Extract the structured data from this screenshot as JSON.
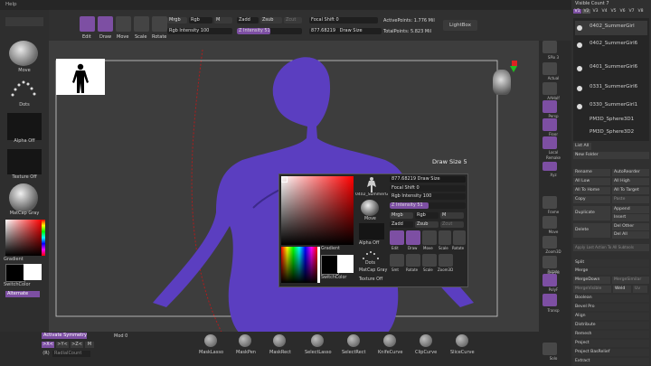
{
  "menu": {
    "help": "Help"
  },
  "toolbar": {
    "projection_master": "Projection Master",
    "edit": "Edit",
    "draw": "Draw",
    "move": "Move",
    "scale": "Scale",
    "rotate": "Rotate",
    "mrgb": "Mrgb",
    "rgb": "Rgb",
    "m": "M",
    "rgb_intensity": "Rgb Intensity 100",
    "zadd": "Zadd",
    "zsub": "Zsub",
    "zcut": "Zcut",
    "z_intensity": "Z Intensity 51",
    "focal_shift": "Focal Shift 0",
    "color_hex": "877.68219",
    "draw_size": "Draw Size",
    "active_points": "ActivePoints: 1.776 Mil",
    "total_points": "TotalPoints: 5.823 Mil",
    "lightbox": "LightBox"
  },
  "left_shelf": {
    "move": "Move",
    "dots": "Dots",
    "alpha_off": "Alpha Off",
    "texture_off": "Texture Off",
    "matcap_gray": "MatCap Gray",
    "gradient": "Gradient",
    "switch_color": "SwitchColor",
    "alternate": "Alternate"
  },
  "viewport": {
    "draw_size_label": "Draw Size 5"
  },
  "right_shelf": {
    "spix": "SPix 3",
    "actual": "Actual",
    "aahalf": "AAHalf",
    "persp": "Persp",
    "floor": "Floor",
    "local": "Local",
    "remake": "Remake",
    "xyz": "Xyz",
    "frame": "Frame",
    "move": "Move",
    "zoom3d": "Zoom3D",
    "rotate": "Rotate",
    "line_fill": "Line Fill",
    "polyf": "PolyF",
    "transp": "Transp",
    "ghost": "Ghost",
    "solo": "Solo"
  },
  "subtool": {
    "visible_count": "Visible Count 7",
    "versions": [
      "V1",
      "V2",
      "V3",
      "V4",
      "V5",
      "V6",
      "V7",
      "V8"
    ],
    "items": [
      "0402_SummerGirl",
      "0402_SummerGirl6",
      "0401_SummerGirl6",
      "0331_SummerGirl6",
      "0330_SummerGirl1",
      "PM3D_Sphere3D1",
      "PM3D_Sphere3D2"
    ],
    "list_all": "List All",
    "new_folder": "New Folder",
    "rename": "Rename",
    "autoreorder": "AutoReorder",
    "all_low": "All Low",
    "all_high": "All High",
    "all_to_home": "All To Home",
    "all_to_target": "All To Target",
    "copy": "Copy",
    "paste": "Paste",
    "duplicate": "Duplicate",
    "append": "Append",
    "insert": "Insert",
    "delete": "Delete",
    "del_other": "Del Other",
    "del_all": "Del All",
    "apply_last": "Apply Last Action To All Subtools",
    "split": "Split",
    "merge": "Merge",
    "merge_down": "MergeDown",
    "merge_similar": "MergeSimilar",
    "merge_visible": "MergeVisible",
    "weld": "Weld",
    "uv": "Uv",
    "boolean": "Boolean",
    "bevel_pro": "Bevel Pro",
    "align": "Align",
    "distribute": "Distribute",
    "remesh": "Remesh",
    "project": "Project",
    "project_bas_relief": "Project BasRelief",
    "extract": "Extract"
  },
  "bottom": {
    "activate_symmetry": "Activate Symmetry",
    "mod": "Mod 0",
    "x": ">X<",
    "y": ">Y<",
    "z": ">Z<",
    "m": "M",
    "r": "(R)",
    "radial_count": "RadialCount",
    "tools": [
      "MaskLasso",
      "MaskPen",
      "MaskRect",
      "SelectLasso",
      "SelectRect",
      "KnifeCurve",
      "ClipCurve",
      "SliceCurve"
    ]
  },
  "popup": {
    "model": "0402_SummerGirl",
    "move": "Move",
    "alpha_off": "Alpha Off",
    "dots": "Dots",
    "matcap_gray": "MatCap Gray",
    "texture_off": "Texture Off",
    "gradient": "Gradient",
    "switch_color": "SwitchColor",
    "hex": "877.68219",
    "draw_size": "Draw Size",
    "focal_shift": "Focal Shift 0",
    "rgb_intensity": "Rgb Intensity 100",
    "z_intensity": "Z Intensity 51",
    "mrgb": "Mrgb",
    "rgb": "Rgb",
    "m": "M",
    "zadd": "Zadd",
    "zsub": "Zsub",
    "zcut": "Zcut",
    "edit": "Edit",
    "draw": "Draw",
    "move_btn": "Move",
    "scale": "Scale",
    "rotate": "Rotate",
    "sub_icons": [
      "Smt",
      "Rotate",
      "Scale",
      "Zoom3D"
    ]
  },
  "colors": {
    "accent": "#7d4fa3",
    "model": "#5b3ec0"
  }
}
